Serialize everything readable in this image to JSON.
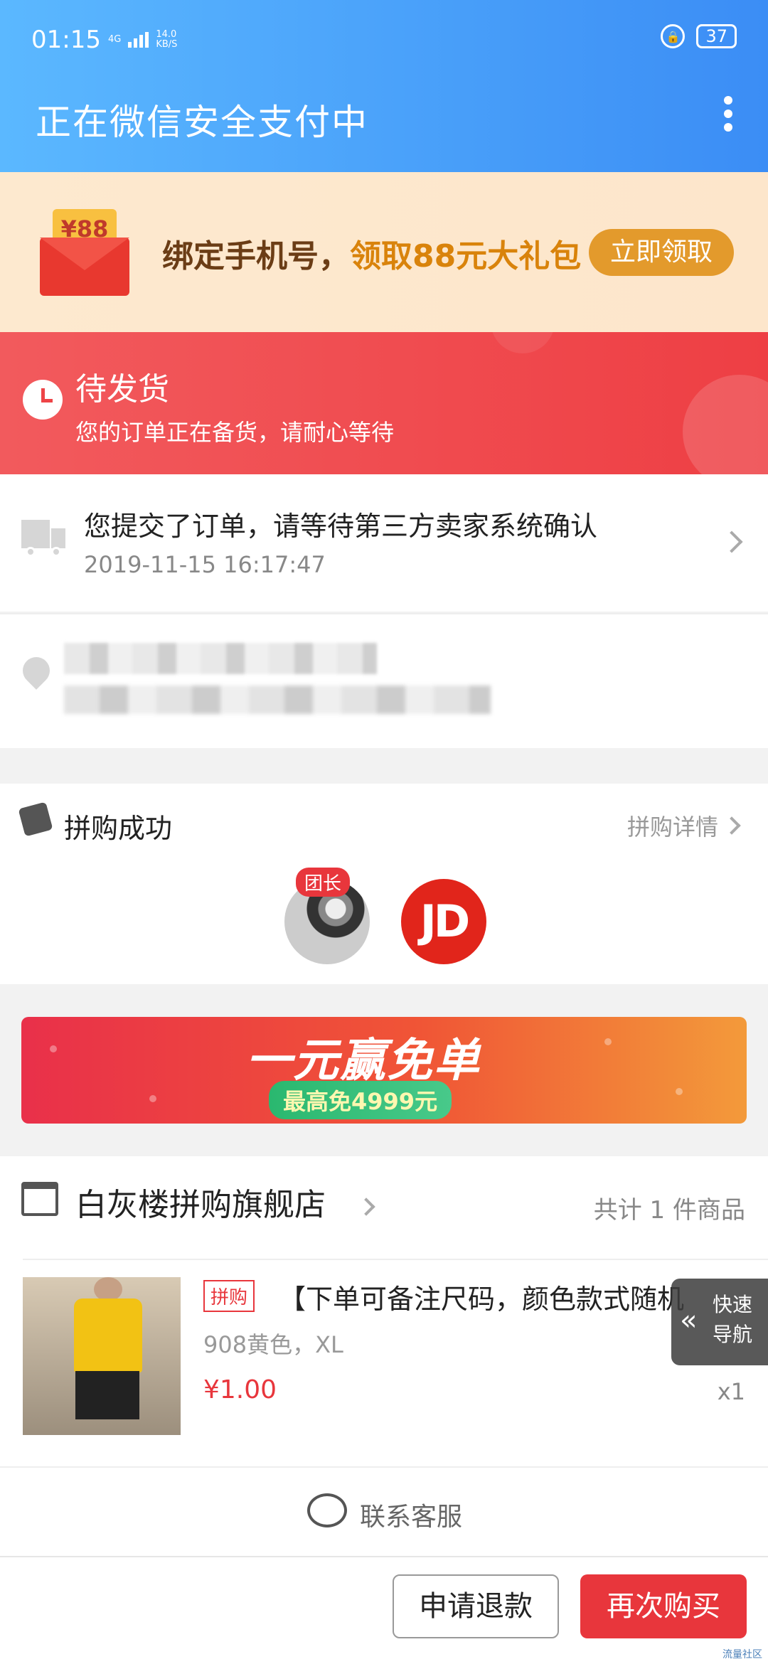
{
  "status_bar": {
    "time": "01:15",
    "network": "4G",
    "speed_value": "14.0",
    "speed_unit": "KB/S",
    "battery": "37"
  },
  "header": {
    "title": "正在微信安全支付中"
  },
  "promo": {
    "envelope_amount": "¥88",
    "text_prefix": "绑定手机号，",
    "text_highlight": "领取88元大礼包",
    "button": "立即领取"
  },
  "order_status": {
    "title": "待发货",
    "subtitle": "您的订单正在备货，请耐心等待"
  },
  "logistics": {
    "message": "您提交了订单，请等待第三方卖家系统确认",
    "time": "2019-11-15 16:17:47"
  },
  "group_buy": {
    "title": "拼购成功",
    "detail_link": "拼购详情",
    "leader_badge": "团长",
    "member_logo": "JD"
  },
  "ad": {
    "title": "一元赢免单",
    "subtitle": "最高免4999元"
  },
  "store": {
    "name": "白灰楼拼购旗舰店",
    "count": "共计 1 件商品",
    "product": {
      "tag": "拼购",
      "name": "【下单可备注尺码，颜色款式随机",
      "spec": "908黄色，XL",
      "price": "¥1.00",
      "qty": "x1"
    }
  },
  "quick_nav": {
    "label": "快速导航"
  },
  "service": {
    "label": "联系客服"
  },
  "actions": {
    "refund": "申请退款",
    "rebuy": "再次购买"
  },
  "watermark": "流量社区"
}
